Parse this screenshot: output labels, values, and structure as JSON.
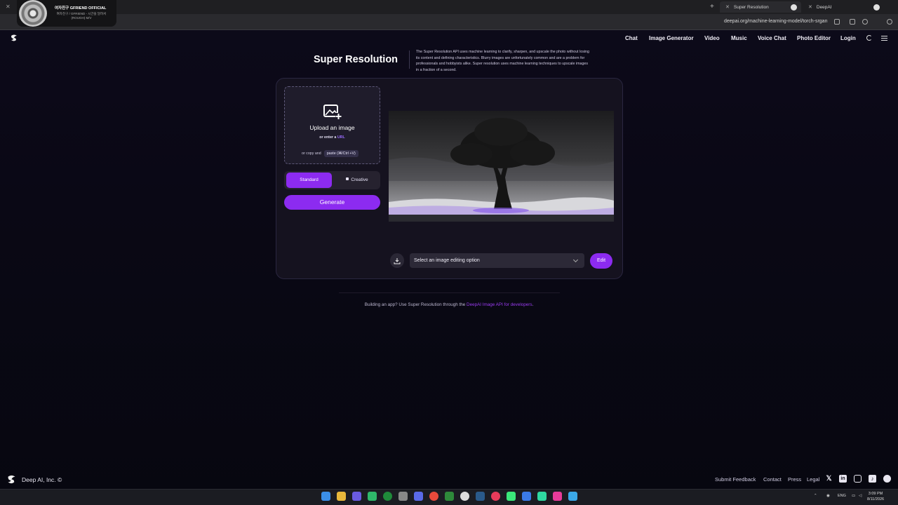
{
  "browser": {
    "tabs": [
      {
        "label": "Super Resolution",
        "active": true
      },
      {
        "label": "DeepAI",
        "active": false
      }
    ],
    "url": "deepai.org/machine-learning-model/torch-srgan"
  },
  "media_overlay": {
    "title": "여자친구 GFRIEND OFFICIAL",
    "subtitle": "여자친구 / GFRIEND - 시간을 달려서 (ROUGH) M/V"
  },
  "nav": {
    "items": [
      "Chat",
      "Image Generator",
      "Video",
      "Music",
      "Voice Chat",
      "Photo Editor",
      "Login"
    ]
  },
  "page": {
    "title": "Super Resolution",
    "description": "The Super Resolution API uses machine learning to clarify, sharpen, and upscale the photo without losing its content and defining characteristics. Blurry images are unfortunately common and are a problem for professionals and hobbyists alike. Super resolution uses machine learning techniques to upscale images in a fraction of a second."
  },
  "upload": {
    "title": "Upload an image",
    "or_enter": "or enter a",
    "url_link": "URL",
    "or_copy": "or copy and",
    "paste_hint": "paste (⌘/Ctrl +V)"
  },
  "mode": {
    "standard": "Standard",
    "creative": "Creative",
    "selected": "Standard"
  },
  "generate_label": "Generate",
  "editor": {
    "select_placeholder": "Select an image editing option",
    "edit_label": "Edit"
  },
  "api_note": {
    "prefix": "Building an app? Use Super Resolution through the",
    "link": "DeepAI Image API for developers",
    "suffix": "."
  },
  "footer": {
    "copyright": "Deep AI, Inc. ©",
    "links": [
      "Submit Feedback",
      "Contact",
      "Press",
      "Legal"
    ],
    "social_icons": [
      "x-icon",
      "linkedin-icon",
      "instagram-icon",
      "tiktok-icon",
      "reddit-icon"
    ]
  },
  "system": {
    "language": "ENG",
    "time": "3:09 PM",
    "date": "8/11/2026"
  },
  "colors": {
    "accent": "#8c2bf0",
    "link": "#9b6cff",
    "background": "#0d0a1a"
  }
}
